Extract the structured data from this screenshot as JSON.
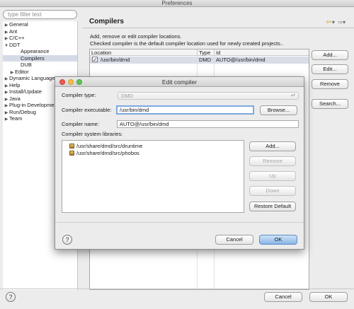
{
  "window": {
    "title": "Preferences"
  },
  "filter": {
    "placeholder": "type filter text"
  },
  "tree": [
    {
      "label": "General",
      "indent": 0,
      "twisty": "▶"
    },
    {
      "label": "Ant",
      "indent": 0,
      "twisty": "▶"
    },
    {
      "label": "C/C++",
      "indent": 0,
      "twisty": "▶"
    },
    {
      "label": "DDT",
      "indent": 0,
      "twisty": "▼"
    },
    {
      "label": "Appearance",
      "indent": 2,
      "twisty": ""
    },
    {
      "label": "Compilers",
      "indent": 2,
      "twisty": "",
      "selected": true
    },
    {
      "label": "DUB",
      "indent": 2,
      "twisty": ""
    },
    {
      "label": "Editor",
      "indent": 1,
      "twisty": "▶"
    },
    {
      "label": "Dynamic Languages",
      "indent": 0,
      "twisty": "▶"
    },
    {
      "label": "Help",
      "indent": 0,
      "twisty": "▶"
    },
    {
      "label": "Install/Update",
      "indent": 0,
      "twisty": "▶"
    },
    {
      "label": "Java",
      "indent": 0,
      "twisty": "▶"
    },
    {
      "label": "Plug-in Development",
      "indent": 0,
      "twisty": "▶"
    },
    {
      "label": "Run/Debug",
      "indent": 0,
      "twisty": "▶"
    },
    {
      "label": "Team",
      "indent": 0,
      "twisty": "▶"
    }
  ],
  "page": {
    "title": "Compilers",
    "desc1": "Add, remove or edit compiler locations.",
    "desc2": "Checked compiler is the default compiler location used for newly created projects..",
    "columns": {
      "location": "Location",
      "type": "Type",
      "id": "Id"
    },
    "row": {
      "location": "/usr/bin/dmd",
      "type": "DMD",
      "id": "AUTO@/usr/bin/dmd",
      "checked": "✓"
    },
    "buttons": {
      "add": "Add...",
      "edit": "Edit...",
      "remove": "Remove",
      "search": "Search..."
    }
  },
  "footer": {
    "cancel": "Cancel",
    "ok": "OK",
    "help": "?"
  },
  "dialog": {
    "title": "Edit compiler",
    "type_label": "Compiler type:",
    "type_value": "DMD",
    "exe_label": "Compiler executable:",
    "exe_value": "/usr/bin/dmd",
    "browse": "Browse...",
    "name_label": "Compiler name:",
    "name_value": "AUTO@/usr/bin/dmd",
    "libs_label": "Compiler system libraries:",
    "libs": [
      "/usr/share/dmd/src/druntime",
      "/usr/share/dmd/src/phobos"
    ],
    "lib_buttons": {
      "add": "Add...",
      "remove": "Remove",
      "up": "Up",
      "down": "Down",
      "restore": "Restore Default"
    },
    "cancel": "Cancel",
    "ok": "OK",
    "help": "?"
  },
  "colors": {
    "selection": "#d5dbe6",
    "accent": "#7ca9df",
    "close": "#ee5b53",
    "minimize": "#f5bd4f",
    "zoom": "#62c655"
  }
}
